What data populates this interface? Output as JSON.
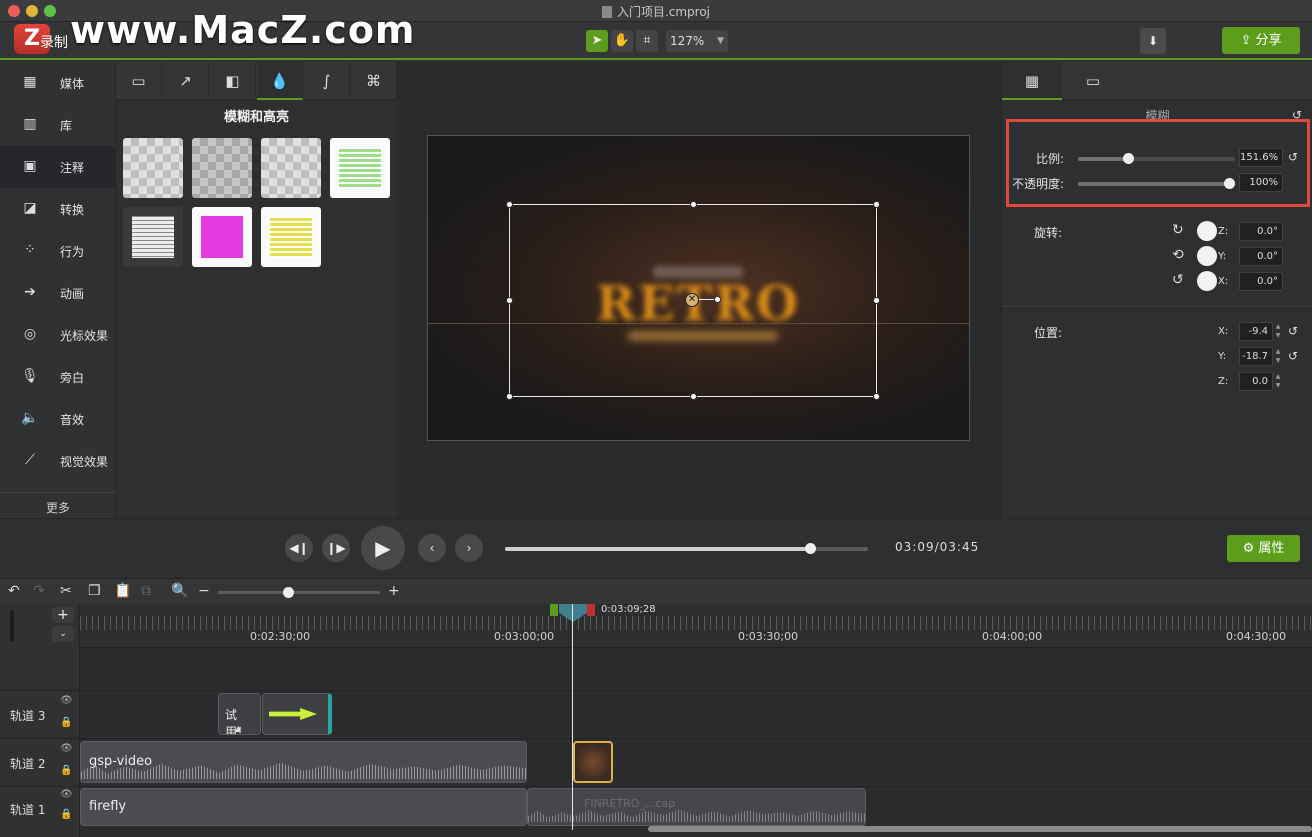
{
  "window": {
    "title": "入门项目.cmproj"
  },
  "watermark": {
    "text": "www.MacZ.com",
    "logo": "Z"
  },
  "toolbar": {
    "record_label": "录制",
    "zoom_value": "127%",
    "share_label": "分享",
    "tools": [
      "pointer-icon",
      "hand-icon",
      "crop-icon"
    ]
  },
  "nav": {
    "items": [
      {
        "label": "媒体",
        "icon": "film-icon"
      },
      {
        "label": "库",
        "icon": "library-icon"
      },
      {
        "label": "注释",
        "icon": "annotation-icon"
      },
      {
        "label": "转换",
        "icon": "transition-icon"
      },
      {
        "label": "行为",
        "icon": "behavior-icon"
      },
      {
        "label": "动画",
        "icon": "animation-icon"
      },
      {
        "label": "光标效果",
        "icon": "cursor-effect-icon"
      },
      {
        "label": "旁白",
        "icon": "microphone-icon"
      },
      {
        "label": "音效",
        "icon": "speaker-icon"
      },
      {
        "label": "视觉效果",
        "icon": "magic-wand-icon"
      }
    ],
    "more_label": "更多"
  },
  "library": {
    "tabs": [
      "callout-icon",
      "arrow-icon",
      "shape-icon",
      "blur-drop-icon",
      "sketch-icon",
      "keystroke-icon"
    ],
    "title": "模糊和高亮",
    "swatch_colors": [
      "#9edc8c",
      "#e23be0",
      "#e6e04a"
    ]
  },
  "canvas": {
    "preview_text": "RETRO"
  },
  "properties": {
    "tabs": [
      "film-icon",
      "callout-icon"
    ],
    "section_title": "模糊",
    "scale_label": "比例:",
    "scale_value": "151.6%",
    "opacity_label": "不透明度:",
    "opacity_value": "100%",
    "rotation_label": "旋转:",
    "rotation": [
      {
        "axis": "Z:",
        "value": "0.0°"
      },
      {
        "axis": "Y:",
        "value": "0.0°"
      },
      {
        "axis": "X:",
        "value": "0.0°"
      }
    ],
    "position_label": "位置:",
    "position": [
      {
        "axis": "X:",
        "value": "-9.4"
      },
      {
        "axis": "Y:",
        "value": "-18.7"
      },
      {
        "axis": "Z:",
        "value": "0.0"
      }
    ],
    "highlight_color": "#e04a3b"
  },
  "transport": {
    "timecode": "03:09/03:45",
    "properties_label": "属性",
    "progress": 0.84
  },
  "timeline": {
    "playhead_time": "0:03:09;28",
    "ruler_labels": [
      "0:02:30;00",
      "0:03:00;00",
      "0:03:30;00",
      "0:04:00;00",
      "0:04:30;00"
    ],
    "tracks": [
      {
        "name": "轨道 3"
      },
      {
        "name": "轨道 2"
      },
      {
        "name": "轨道 1"
      }
    ],
    "clips": {
      "trial_label": "试用！",
      "gsp_video": "gsp-video",
      "firefly": "firefly",
      "retro_clip": "FINRETRO_...cap"
    }
  },
  "accent_color": "#5c9e1c"
}
